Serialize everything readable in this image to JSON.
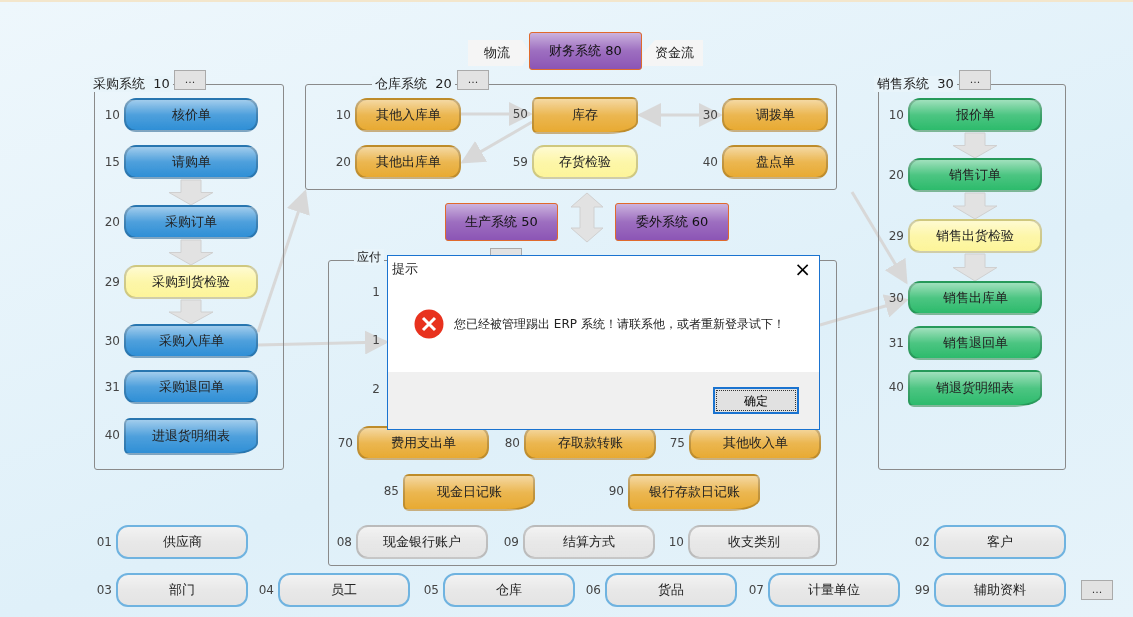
{
  "top_flow": {
    "left_label": "物流",
    "center_system": "财务系统 80",
    "right_label": "资金流"
  },
  "groups": [
    {
      "title": "采购系统",
      "code": "10",
      "more": "...",
      "items": [
        {
          "code": "10",
          "label": "核价单",
          "kind": "pill",
          "color": "#2f8fd6"
        },
        {
          "code": "15",
          "label": "请购单",
          "kind": "pill",
          "color": "#2f8fd6"
        },
        {
          "code": "20",
          "label": "采购订单",
          "kind": "pill",
          "color": "#2f8fd6"
        },
        {
          "code": "29",
          "label": "采购到货检验",
          "kind": "pill",
          "color": "#fdf59a"
        },
        {
          "code": "30",
          "label": "采购入库单",
          "kind": "pill",
          "color": "#2f8fd6"
        },
        {
          "code": "31",
          "label": "采购退回单",
          "kind": "pill",
          "color": "#2f8fd6"
        },
        {
          "code": "40",
          "label": "进退货明细表",
          "kind": "document",
          "color": "#2f8fd6"
        }
      ]
    },
    {
      "title": "仓库系统",
      "code": "20",
      "more": "...",
      "items": [
        {
          "code": "10",
          "label": "其他入库单",
          "kind": "pill",
          "color": "#e8aa32"
        },
        {
          "code": "50",
          "label": "库存",
          "kind": "document",
          "color": "#e8aa32"
        },
        {
          "code": "30",
          "label": "调拨单",
          "kind": "pill",
          "color": "#e8aa32"
        },
        {
          "code": "20",
          "label": "其他出库单",
          "kind": "pill",
          "color": "#e8aa32"
        },
        {
          "code": "59",
          "label": "存货检验",
          "kind": "pill",
          "color": "#fdf59a"
        },
        {
          "code": "40",
          "label": "盘点单",
          "kind": "pill",
          "color": "#e8aa32"
        }
      ]
    },
    {
      "title": "应付",
      "partial_codes": [
        "1",
        "1",
        "2"
      ],
      "items": [
        {
          "code": "70",
          "label": "费用支出单",
          "kind": "pill",
          "color": "#e8aa32"
        },
        {
          "code": "80",
          "label": "存取款转账",
          "kind": "pill",
          "color": "#e8aa32"
        },
        {
          "code": "75",
          "label": "其他收入单",
          "kind": "pill",
          "color": "#e8aa32"
        },
        {
          "code": "85",
          "label": "现金日记账",
          "kind": "document",
          "color": "#e8aa32"
        },
        {
          "code": "90",
          "label": "银行存款日记账",
          "kind": "document",
          "color": "#e8aa32"
        },
        {
          "code": "08",
          "label": "现金银行账户",
          "kind": "pill",
          "color": "#e4e4e4"
        },
        {
          "code": "09",
          "label": "结算方式",
          "kind": "pill",
          "color": "#e4e4e4"
        },
        {
          "code": "10",
          "label": "收支类别",
          "kind": "pill",
          "color": "#e4e4e4"
        }
      ]
    },
    {
      "title": "销售系统",
      "code": "30",
      "more": "...",
      "items": [
        {
          "code": "10",
          "label": "报价单",
          "kind": "pill",
          "color": "#2dbb6c"
        },
        {
          "code": "20",
          "label": "销售订单",
          "kind": "pill",
          "color": "#2dbb6c"
        },
        {
          "code": "29",
          "label": "销售出货检验",
          "kind": "pill",
          "color": "#fdf59a"
        },
        {
          "code": "30",
          "label": "销售出库单",
          "kind": "pill",
          "color": "#2dbb6c"
        },
        {
          "code": "31",
          "label": "销售退回单",
          "kind": "pill",
          "color": "#2dbb6c"
        },
        {
          "code": "40",
          "label": "销退货明细表",
          "kind": "document",
          "color": "#2dbb6c"
        }
      ]
    }
  ],
  "systems": [
    "生产系统 50",
    "委外系统 60"
  ],
  "basics": [
    {
      "code": "01",
      "label": "供应商"
    },
    {
      "code": "02",
      "label": "客户"
    },
    {
      "code": "03",
      "label": "部门"
    },
    {
      "code": "04",
      "label": "员工"
    },
    {
      "code": "05",
      "label": "仓库"
    },
    {
      "code": "06",
      "label": "货品"
    },
    {
      "code": "07",
      "label": "计量单位"
    },
    {
      "code": "99",
      "label": "辅助资料"
    }
  ],
  "basics_more": "...",
  "dialog": {
    "title": "提示",
    "close": "×",
    "message": "您已经被管理踢出 ERP 系统！请联系他，或者重新登录试下！",
    "ok": "确定"
  }
}
